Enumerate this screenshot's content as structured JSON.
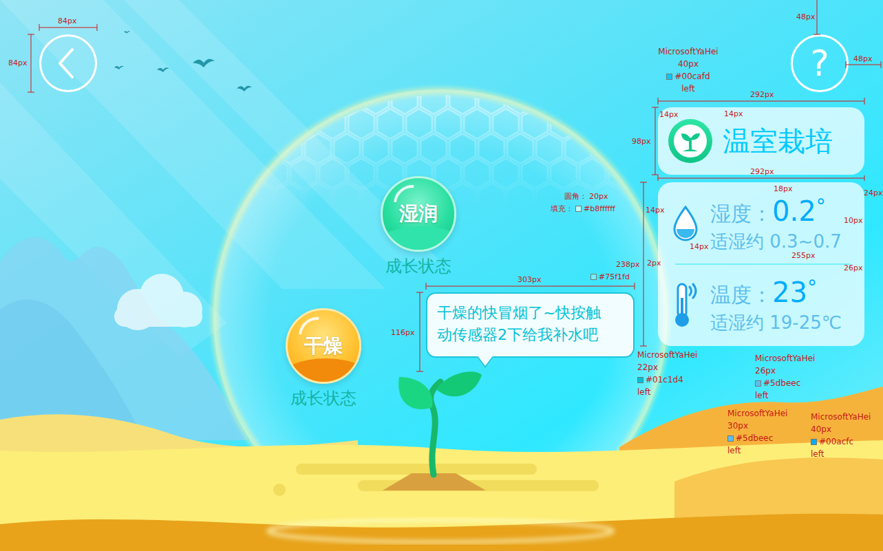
{
  "help_button": {
    "label": "?"
  },
  "title_card": {
    "title": "温室栽培"
  },
  "readings": [
    {
      "kind": "humidity",
      "label": "湿度：",
      "value": "0.2",
      "unit": "°",
      "range": "适湿约 0.3~0.7"
    },
    {
      "kind": "temperature",
      "label": "温度：",
      "value": "23",
      "unit": "°",
      "range": "适湿约 19-25℃"
    }
  ],
  "states": [
    {
      "kind": "moist",
      "label": "湿润",
      "caption": "成长状态"
    },
    {
      "kind": "dry",
      "label": "干燥",
      "caption": "成长状态"
    }
  ],
  "speech_bubble": {
    "text": "干燥的快冒烟了~快按触动传感器2下给我补水吧"
  },
  "annotations": {
    "dimensions": [
      {
        "text": "84px"
      },
      {
        "text": "84px"
      },
      {
        "text": "48px"
      },
      {
        "text": "48px"
      },
      {
        "text": "292px"
      },
      {
        "text": "98px"
      },
      {
        "text": "14px"
      },
      {
        "text": "14px"
      },
      {
        "text": "292px"
      },
      {
        "text": "18px"
      },
      {
        "text": "24px"
      },
      {
        "text": "14px"
      },
      {
        "text": "14px"
      },
      {
        "text": "10px"
      },
      {
        "text": "238px"
      },
      {
        "text": "2px"
      },
      {
        "text": "255px"
      },
      {
        "text": "26px"
      },
      {
        "text": "303px"
      },
      {
        "text": "116px"
      }
    ],
    "font_specs": [
      {
        "font": "MicrosoftYaHei",
        "size": "40px",
        "color": "#00cafd",
        "align": "left"
      },
      {
        "font": "MicrosoftYaHei",
        "size": "22px",
        "color": "#01c1d4",
        "align": "left"
      },
      {
        "font": "MicrosoftYaHei",
        "size": "26px",
        "color": "#5dbeec",
        "align": "left"
      },
      {
        "font": "MicrosoftYaHei",
        "size": "30px",
        "color": "#5dbeec",
        "align": "left"
      },
      {
        "font": "MicrosoftYaHei",
        "size": "40px",
        "color": "#00acfc",
        "align": "left"
      }
    ],
    "notes": [
      {
        "label": "圆角：",
        "value": "20px",
        "swatch": false
      },
      {
        "label": "填充：",
        "value": "#b8ffffff",
        "swatch": true
      },
      {
        "value": "#75f1fd",
        "swatch": true
      }
    ]
  }
}
